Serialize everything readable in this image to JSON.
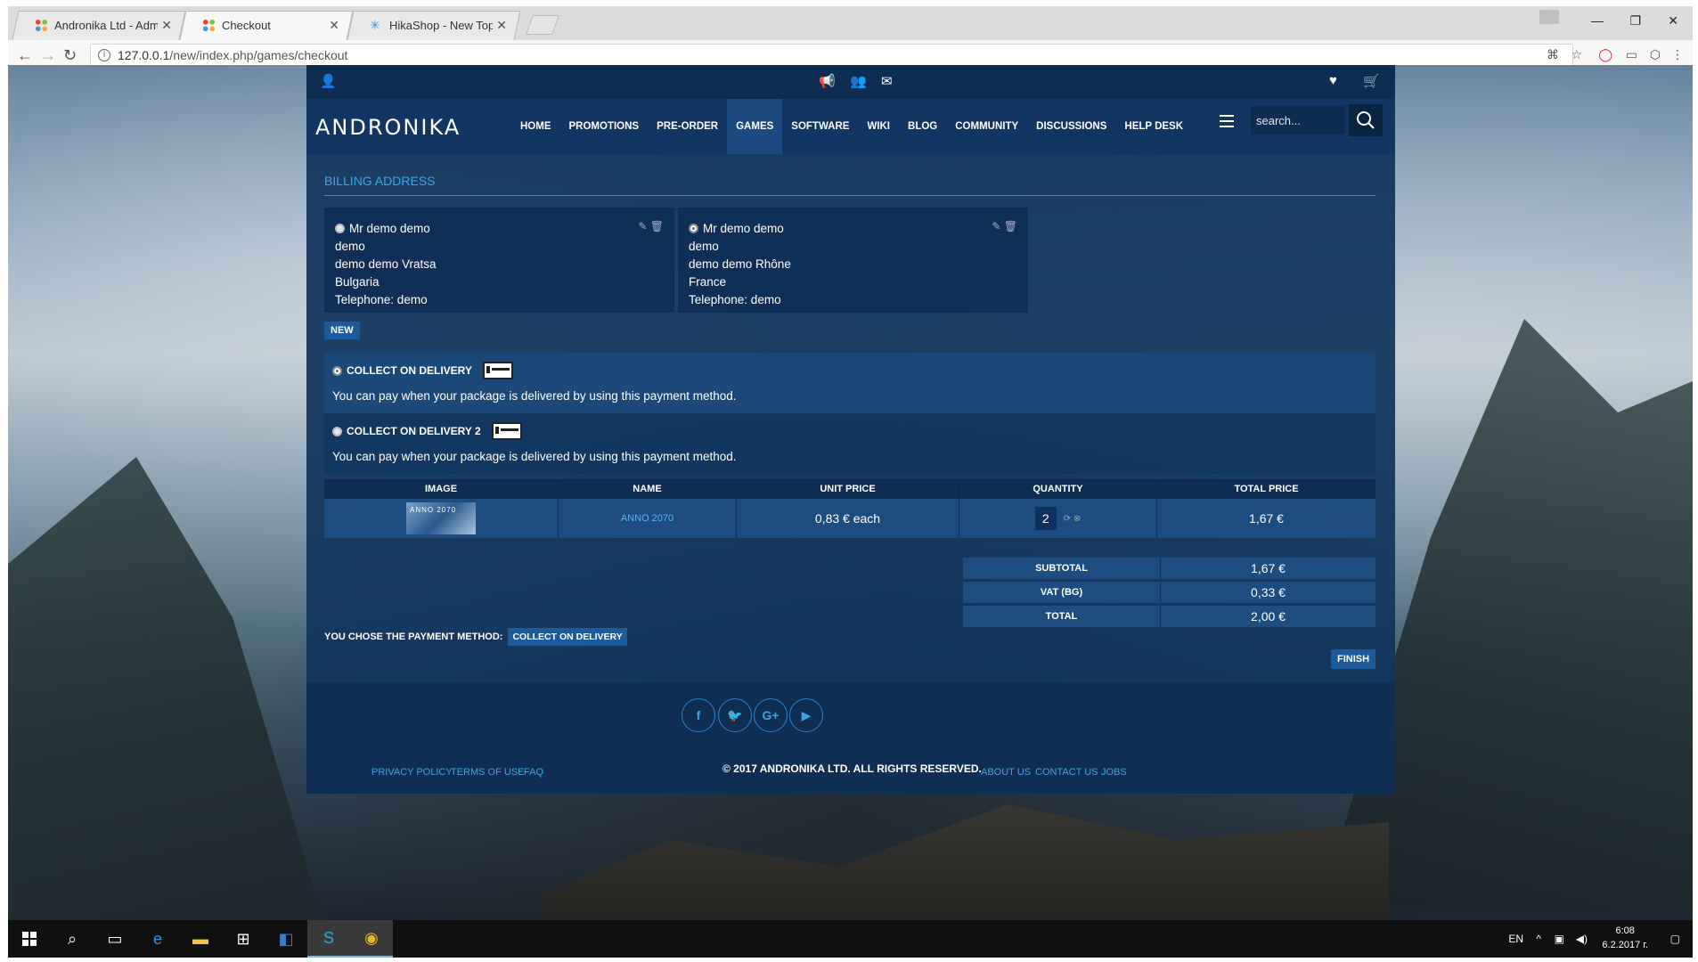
{
  "browser": {
    "tabs": [
      {
        "label": "Andronika Ltd - Adminis",
        "active": false
      },
      {
        "label": "Checkout",
        "active": true
      },
      {
        "label": "HikaShop - New Topic -",
        "active": false
      }
    ],
    "url_host": "127.0.0.1",
    "url_path": "/new/index.php/games/checkout"
  },
  "site": {
    "logo": "ANDRONIKA",
    "nav": [
      "HOME",
      "PROMOTIONS",
      "PRE-ORDER",
      "GAMES",
      "SOFTWARE",
      "WIKI",
      "BLOG",
      "COMMUNITY",
      "DISCUSSIONS",
      "HELP DESK"
    ],
    "active_nav": "GAMES",
    "search_placeholder": "search..."
  },
  "billing": {
    "title": "BILLING ADDRESS",
    "addresses": [
      {
        "name": "Mr demo demo",
        "line1": "demo",
        "line2": "demo demo Vratsa",
        "country": "Bulgaria",
        "phone": "Telephone: demo",
        "selected": false
      },
      {
        "name": "Mr demo demo",
        "line1": "demo",
        "line2": "demo demo Rhône",
        "country": "France",
        "phone": "Telephone: demo",
        "selected": true
      }
    ],
    "new_label": "NEW"
  },
  "payment": {
    "methods": [
      {
        "name": "COLLECT ON DELIVERY",
        "desc": "You can pay when your package is delivered by using this payment method."
      },
      {
        "name": "COLLECT ON DELIVERY 2",
        "desc": "You can pay when your package is delivered by using this payment method."
      }
    ]
  },
  "cart": {
    "headers": [
      "IMAGE",
      "NAME",
      "UNIT PRICE",
      "QUANTITY",
      "TOTAL PRICE"
    ],
    "items": [
      {
        "image_text": "ANNO 2070",
        "name": "ANNO 2070",
        "unit_price": "0,83 € each",
        "quantity": "2",
        "total": "1,67 €"
      }
    ],
    "totals": [
      {
        "label": "SUBTOTAL",
        "value": "1,67 €"
      },
      {
        "label": "VAT (BG)",
        "value": "0,33 €"
      },
      {
        "label": "TOTAL",
        "value": "2,00 €"
      }
    ]
  },
  "chosen": {
    "label": "YOU CHOSE THE PAYMENT METHOD:",
    "method": "COLLECT ON DELIVERY"
  },
  "finish_label": "FINISH",
  "footer": {
    "social": [
      "f",
      "t",
      "G+",
      "yt"
    ],
    "left_links": [
      "PRIVACY POLICY",
      "TERMS OF USE",
      "FAQ"
    ],
    "copyright": "© 2017 ANDRONIKA LTD. ALL RIGHTS RESERVED.",
    "right_links": [
      "ABOUT US",
      "CONTACT US",
      "JOBS"
    ]
  },
  "taskbar": {
    "lang": "EN",
    "time": "6:08",
    "date": "6.2.2017 г."
  },
  "colors": {
    "accent": "#3ba6e6",
    "site_bg": "#12345c",
    "button": "#1d5a9a"
  }
}
